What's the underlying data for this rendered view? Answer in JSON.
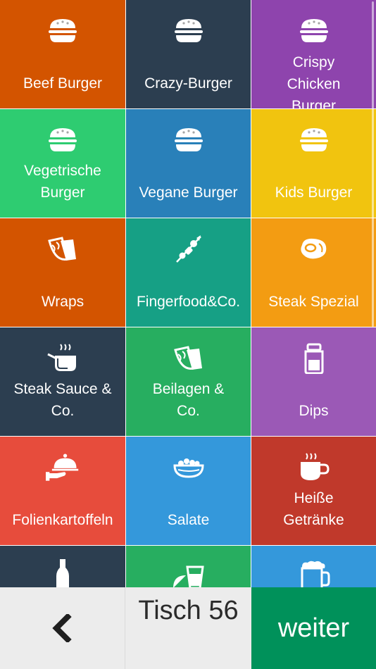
{
  "categories": [
    {
      "label": "Beef Burger",
      "icon": "burger-icon",
      "color": "#d35400"
    },
    {
      "label": "Crazy-Burger",
      "icon": "burger-icon",
      "color": "#2c3e50"
    },
    {
      "label": "Crispy\nChicken\nBurger",
      "icon": "burger-icon",
      "color": "#8e44ad"
    },
    {
      "label": "Vegetrische\nBurger",
      "icon": "burger-icon",
      "color": "#2ecc71"
    },
    {
      "label": "Vegane Burger",
      "icon": "burger-icon",
      "color": "#2980b9"
    },
    {
      "label": "Kids Burger",
      "icon": "burger-icon",
      "color": "#f1c40f"
    },
    {
      "label": "Wraps",
      "icon": "wrap-icon",
      "color": "#d35400"
    },
    {
      "label": "Fingerfood&Co.",
      "icon": "skewer-icon",
      "color": "#16a085"
    },
    {
      "label": "Steak Spezial",
      "icon": "steak-icon",
      "color": "#f39c12"
    },
    {
      "label": "Steak Sauce &\nCo.",
      "icon": "cooking-pot-icon",
      "color": "#2c3e50"
    },
    {
      "label": "Beilagen &\nCo.",
      "icon": "wrap-icon",
      "color": "#27ae60"
    },
    {
      "label": "Dips",
      "icon": "jar-icon",
      "color": "#9b59b6"
    },
    {
      "label": "Folienkartoffeln",
      "icon": "serving-cloche-icon",
      "color": "#e74c3c"
    },
    {
      "label": "Salate",
      "icon": "salad-bowl-icon",
      "color": "#3498db"
    },
    {
      "label": "Heiße\nGetränke",
      "icon": "hot-cup-icon",
      "color": "#c0392b"
    },
    {
      "label": "",
      "icon": "bottle-icon",
      "color": "#2c3e50"
    },
    {
      "label": "",
      "icon": "lemon-glass-icon",
      "color": "#27ae60"
    },
    {
      "label": "",
      "icon": "beer-mug-icon",
      "color": "#3498db"
    }
  ],
  "footer": {
    "back_icon": "chevron-left-icon",
    "table_label": "Tisch 56",
    "next_label": "weiter",
    "next_color": "#00915a"
  }
}
